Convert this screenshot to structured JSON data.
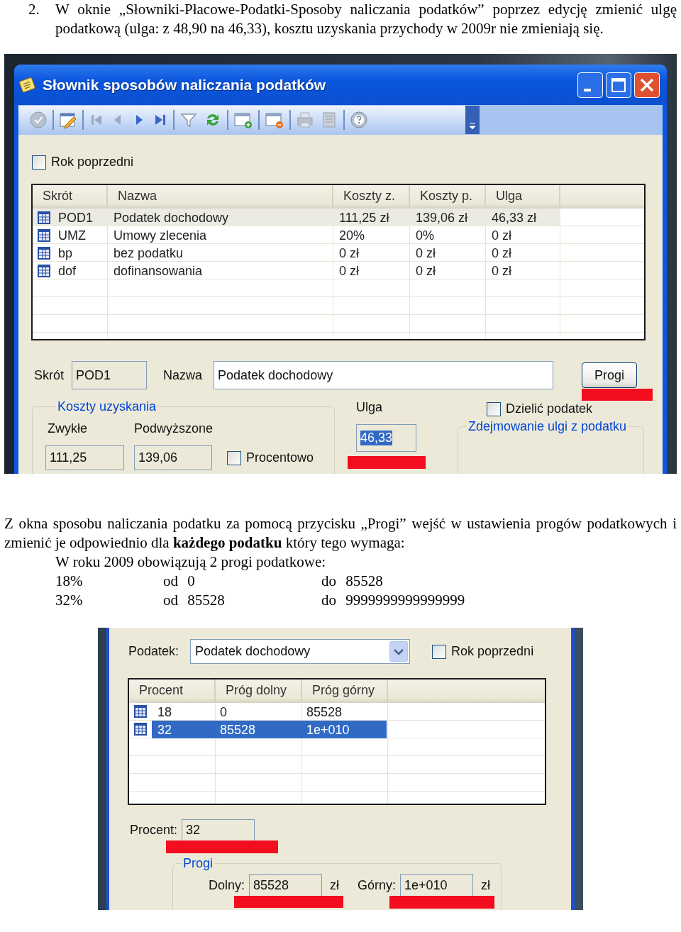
{
  "instruction": {
    "number": "2.",
    "text": "W oknie „Słowniki-Płacowe-Podatki-Sposoby naliczania podatków” poprzez edycję zmienić ulgę podatkową (ulga: z 48,90 na 46,33), kosztu uzyskania przychody w 2009r nie zmieniają się."
  },
  "window_1": {
    "title": "Słownik sposobów naliczania podatków",
    "rok_poprzedni": {
      "label": "Rok poprzedni",
      "checked": false
    },
    "table": {
      "columns": [
        "Skrót",
        "Nazwa",
        "Koszty z.",
        "Koszty p.",
        "Ulga"
      ],
      "rows": [
        {
          "cells": [
            "POD1",
            "Podatek dochodowy",
            "111,25 zł",
            "139,06 zł",
            "46,33 zł"
          ],
          "selected": true
        },
        {
          "cells": [
            "UMZ",
            "Umowy zlecenia",
            "20%",
            "0%",
            "0 zł"
          ],
          "selected": false
        },
        {
          "cells": [
            "bp",
            "bez podatku",
            "0 zł",
            "0 zł",
            "0 zł"
          ],
          "selected": false
        },
        {
          "cells": [
            "dof",
            "dofinansowania",
            "0 zł",
            "0 zł",
            "0 zł"
          ],
          "selected": false
        }
      ]
    },
    "skrot_label": "Skrót",
    "skrot": "POD1",
    "nazwa_label": "Nazwa",
    "nazwa": "Podatek dochodowy",
    "progi_button": "Progi",
    "koszty_group": "Koszty uzyskania",
    "zwykle_label": "Zwykłe",
    "zwykle": "111,25",
    "podwyzszone_label": "Podwyższone",
    "podwyzszone": "139,06",
    "procentowo": {
      "label": "Procentowo",
      "checked": false
    },
    "ulga_label": "Ulga",
    "ulga": "46,33",
    "dzielic": {
      "label": "Dzielić podatek",
      "checked": false
    },
    "zdejmowanie_group": "Zdejmowanie ulgi z podatku"
  },
  "paragraph": "Z okna sposobu naliczania podatku za pomocą przycisku „Progi” wejść w ustawienia progów podatkowych i zmienić je odpowiednio dla **każdego podatku** który tego wymaga:",
  "thresholds_intro": "W roku 2009 obowiązują 2 progi podatkowe:",
  "thresholds": [
    {
      "rate": "18%",
      "from": "od 0",
      "to": "do 85528"
    },
    {
      "rate": "32%",
      "from": "od 85528",
      "to": "do 9999999999999999"
    }
  ],
  "window_2": {
    "podatek_label": "Podatek:",
    "podatek": "Podatek dochodowy",
    "rok_poprzedni": {
      "label": "Rok poprzedni",
      "checked": false
    },
    "table": {
      "columns": [
        "Procent",
        "Próg dolny",
        "Próg górny"
      ],
      "rows": [
        {
          "cells": [
            "18",
            "0",
            "85528"
          ],
          "selected": false
        },
        {
          "cells": [
            "32",
            "85528",
            "1e+010"
          ],
          "selected": true
        }
      ]
    },
    "procent_label": "Procent:",
    "procent": "32",
    "progi_group": "Progi",
    "dolny_label": "Dolny:",
    "dolny": "85528",
    "dolny_unit": "zł",
    "gorny_label": "Górny:",
    "gorny": "1e+010",
    "gorny_unit": "zł"
  }
}
